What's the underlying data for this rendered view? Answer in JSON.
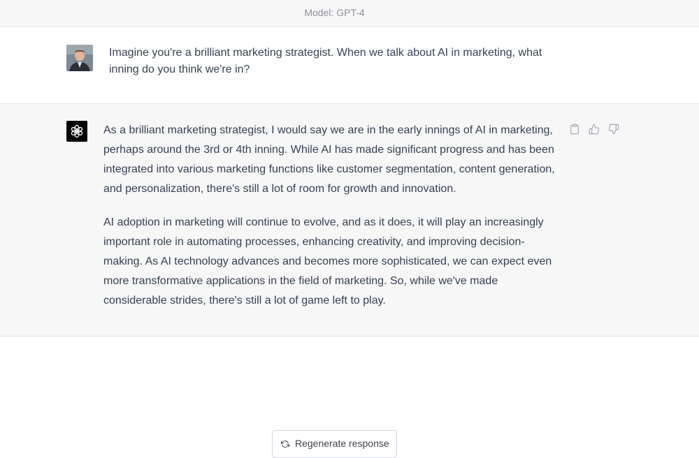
{
  "header": {
    "model_label": "Model: GPT-4"
  },
  "conversation": {
    "user_message": {
      "avatar_icon": "user-photo-avatar",
      "text": "Imagine you're a brilliant marketing strategist. When we talk about AI in marketing, what inning do you think we're in?"
    },
    "assistant_message": {
      "avatar_icon": "openai-logo-icon",
      "paragraphs": [
        "As a brilliant marketing strategist, I would say we are in the early innings of AI in marketing, perhaps around the 3rd or 4th inning. While AI has made significant progress and has been integrated into various marketing functions like customer segmentation, content generation, and personalization, there's still a lot of room for growth and innovation.",
        "AI adoption in marketing will continue to evolve, and as it does, it will play an increasingly important role in automating processes, enhancing creativity, and improving decision-making. As AI technology advances and becomes more sophisticated, we can expect even more transformative applications in the field of marketing. So, while we've made considerable strides, there's still a lot of game left to play."
      ],
      "actions": [
        "clipboard-icon",
        "thumbs-up-icon",
        "thumbs-down-icon"
      ]
    }
  },
  "footer": {
    "regenerate_label": "Regenerate response",
    "regenerate_icon": "refresh-icon"
  },
  "colors": {
    "assistant_bg": "#f7f7f8",
    "text": "#374151",
    "muted": "#8e8ea0"
  }
}
